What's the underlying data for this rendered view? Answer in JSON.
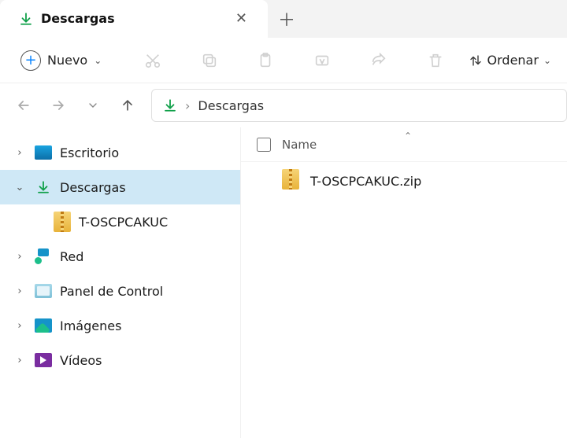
{
  "tab": {
    "title": "Descargas"
  },
  "toolbar": {
    "new_label": "Nuevo",
    "sort_label": "Ordenar"
  },
  "breadcrumb": {
    "current": "Descargas"
  },
  "tree": {
    "items": [
      {
        "label": "Escritorio"
      },
      {
        "label": "Descargas"
      },
      {
        "label": "T-OSCPCAKUC"
      },
      {
        "label": "Red"
      },
      {
        "label": "Panel de Control"
      },
      {
        "label": "Imágenes"
      },
      {
        "label": "Vídeos"
      }
    ]
  },
  "columns": {
    "name": "Name"
  },
  "files": [
    {
      "name": "T-OSCPCAKUC.zip"
    }
  ]
}
